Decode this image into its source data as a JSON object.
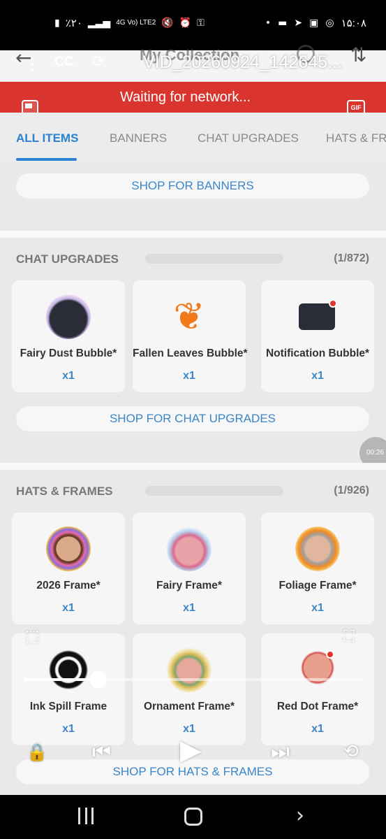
{
  "status_bar": {
    "battery": "٪۲۰",
    "network": "4G Vo) LTE2",
    "time": "۱۵:۰۸"
  },
  "header": {
    "title": "My Collection",
    "back_icon": "back-arrow-icon",
    "search_icon": "search-icon",
    "sort_icon": "sort-icon"
  },
  "video_overlay": {
    "cc_label": "CC",
    "filename": "VID_20260924_142645..."
  },
  "network_banner": {
    "text": "Waiting for network...",
    "gif_label": "GIF"
  },
  "tabs": [
    {
      "label": "ALL ITEMS",
      "active": true
    },
    {
      "label": "BANNERS",
      "active": false
    },
    {
      "label": "CHAT UPGRADES",
      "active": false
    },
    {
      "label": "HATS & FRA",
      "active": false
    }
  ],
  "banners": {
    "shop_label": "SHOP FOR BANNERS"
  },
  "chat_upgrades": {
    "title": "CHAT UPGRADES",
    "count": "(1/872)",
    "items": [
      {
        "name": "Fairy Dust Bubble*",
        "qty": "x1",
        "icon": "fairy-dust-bubble-icon"
      },
      {
        "name": "Fallen Leaves Bubble*",
        "qty": "x1",
        "icon": "maple-leaf-icon"
      },
      {
        "name": "Notification Bubble*",
        "qty": "x1",
        "icon": "notification-bubble-icon"
      }
    ],
    "shop_label": "SHOP FOR CHAT UPGRADES"
  },
  "hats_frames": {
    "title": "HATS & FRAMES",
    "count": "(1/926)",
    "items": [
      {
        "name": "2026 Frame*",
        "qty": "x1",
        "icon": "frame-2026-icon"
      },
      {
        "name": "Fairy Frame*",
        "qty": "x1",
        "icon": "fairy-frame-icon"
      },
      {
        "name": "Foliage Frame*",
        "qty": "x1",
        "icon": "foliage-frame-icon"
      },
      {
        "name": "Ink Spill Frame",
        "qty": "x1",
        "icon": "ink-spill-frame-icon"
      },
      {
        "name": "Ornament Frame*",
        "qty": "x1",
        "icon": "ornament-frame-icon"
      },
      {
        "name": "Red Dot Frame*",
        "qty": "x1",
        "icon": "red-dot-frame-icon"
      }
    ],
    "shop_label": "SHOP FOR HATS & FRAMES"
  },
  "side_timer": "00:26",
  "player": {
    "progress": 0.22
  },
  "colors": {
    "accent": "#2b82d1",
    "banner_red": "#d9352e",
    "qty_blue": "#3a86c8"
  }
}
